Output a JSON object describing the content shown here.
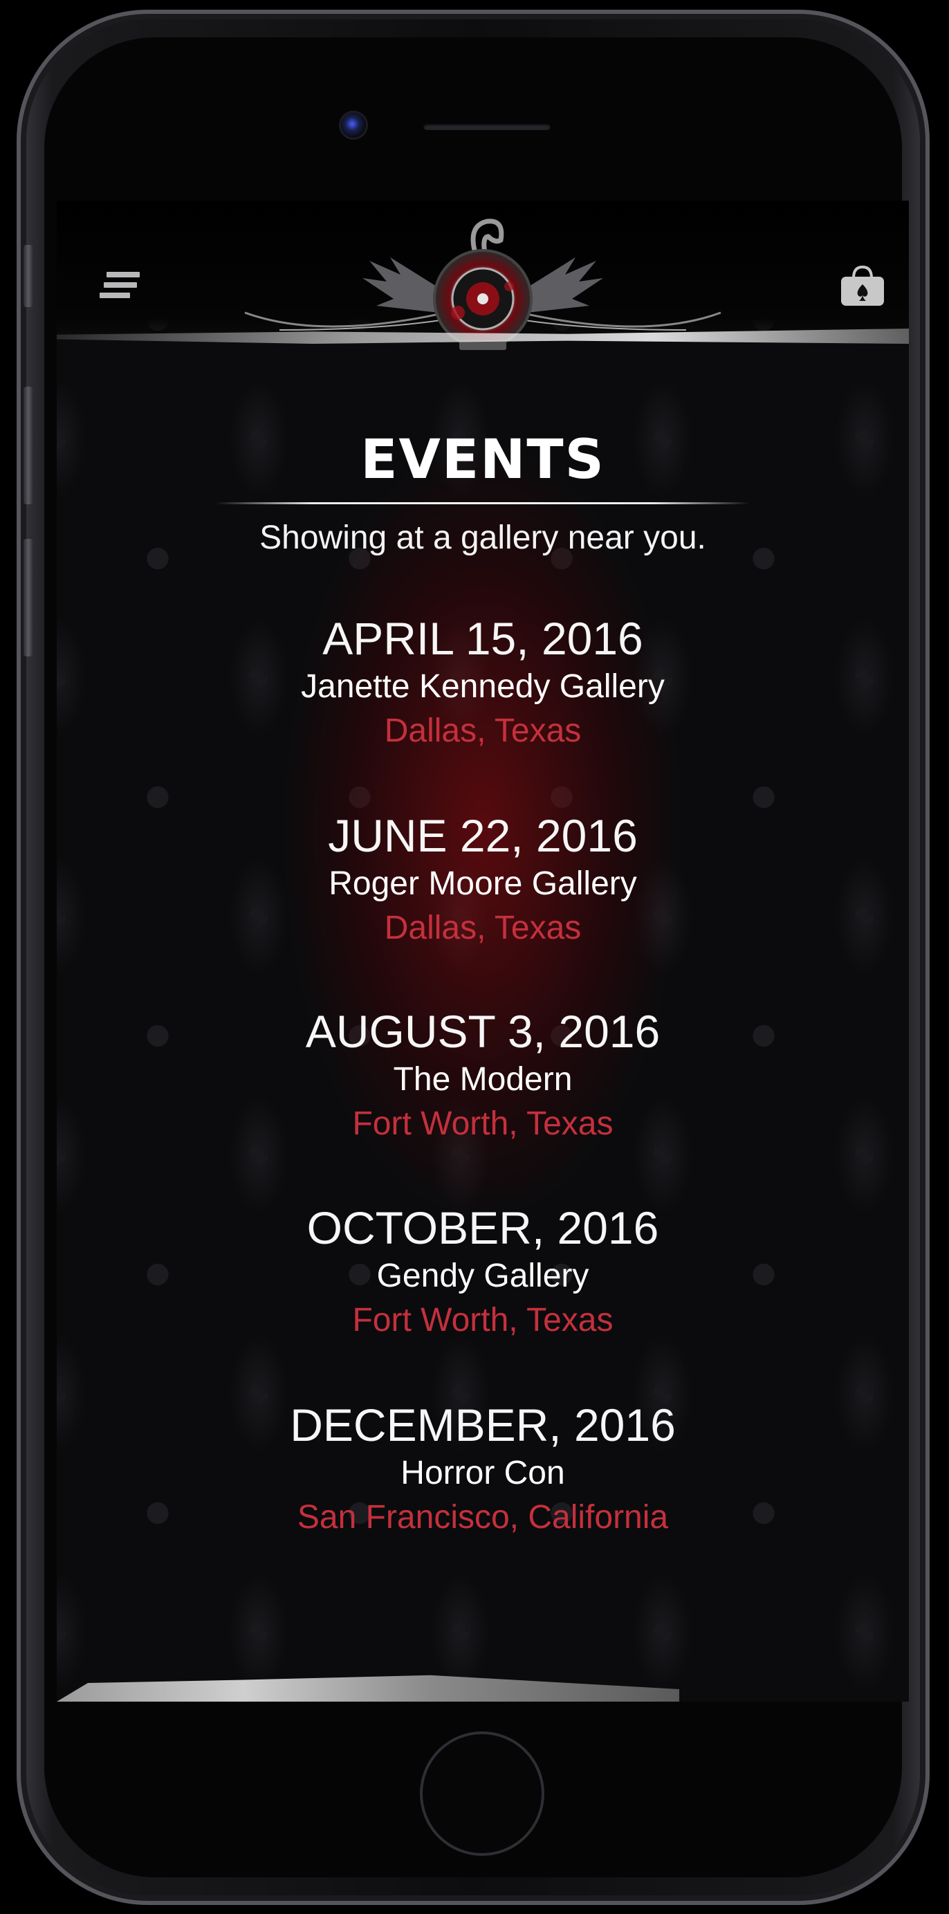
{
  "header": {
    "menu_icon": "hamburger-menu-icon",
    "logo": "winged-emblem-logo",
    "bag_icon": "shopping-bag-icon"
  },
  "page": {
    "title": "EVENTS",
    "subtitle": "Showing at a gallery near you."
  },
  "events": [
    {
      "date": "APRIL 15, 2016",
      "venue": "Janette Kennedy Gallery",
      "location": "Dallas, Texas"
    },
    {
      "date": "JUNE 22, 2016",
      "venue": "Roger Moore Gallery",
      "location": "Dallas, Texas"
    },
    {
      "date": "AUGUST 3, 2016",
      "venue": "The Modern",
      "location": "Fort Worth, Texas"
    },
    {
      "date": "OCTOBER, 2016",
      "venue": "Gendy Gallery",
      "location": "Fort Worth, Texas"
    },
    {
      "date": "DECEMBER, 2016",
      "venue": "Horror Con",
      "location": "San Francisco, California"
    }
  ],
  "colors": {
    "accent_red": "#c5303d",
    "text_white": "#ffffff",
    "background": "#0b0b0d"
  }
}
